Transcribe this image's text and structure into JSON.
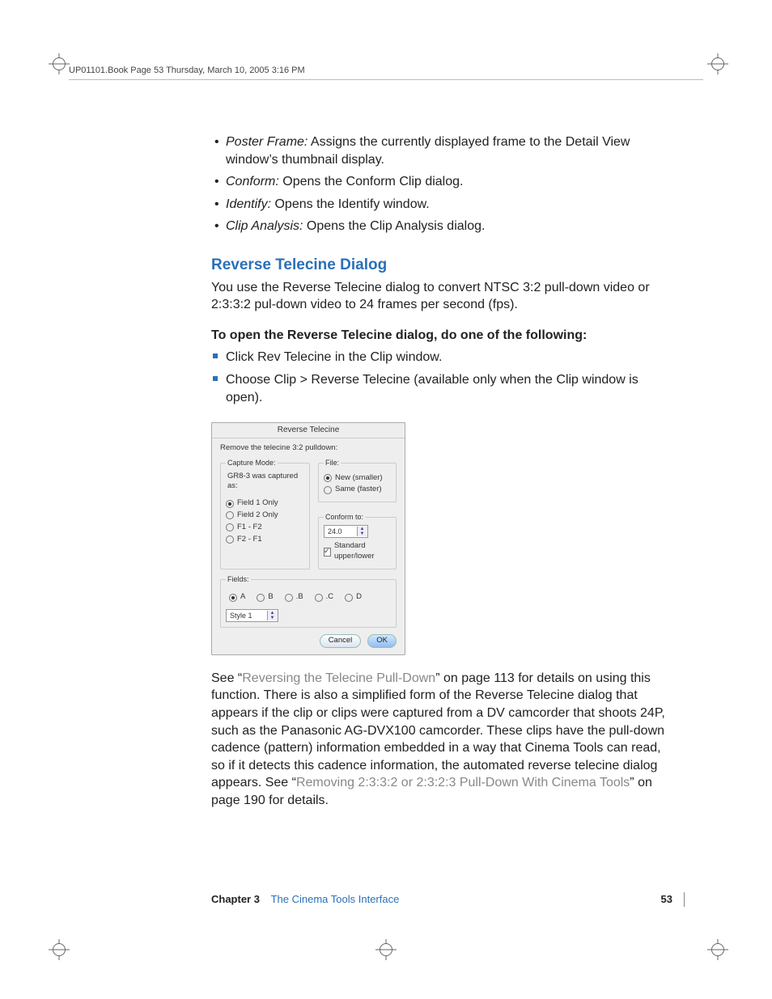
{
  "header": {
    "line": "UP01101.Book  Page 53  Thursday, March 10, 2005  3:16 PM"
  },
  "bullets": {
    "pf_label": "Poster Frame:",
    "pf_text": "  Assigns the currently displayed frame to the Detail View window’s thumbnail display.",
    "conf_label": "Conform:",
    "conf_text": "  Opens the Conform Clip dialog.",
    "id_label": "Identify:",
    "id_text": "  Opens the Identify window.",
    "ca_label": "Clip Analysis:",
    "ca_text": "  Opens the Clip Analysis dialog."
  },
  "section": {
    "heading": "Reverse Telecine Dialog",
    "intro": "You use the Reverse Telecine dialog to convert NTSC 3:2 pull-down video or 2:3:3:2 pul-down video to 24 frames per second (fps).",
    "open_label": "To open the Reverse Telecine dialog, do one of the following:",
    "steps": {
      "s1": "Click Rev Telecine in the Clip window.",
      "s2": "Choose Clip > Reverse Telecine (available only when the Clip window is open)."
    },
    "after1a": "See “",
    "after1_link": "Reversing the Telecine Pull-Down",
    "after1b": "” on page 113 for details on using this function. There is also a simplified form of the Reverse Telecine dialog that appears if the clip or clips were captured from a DV camcorder that shoots 24P, such as the Panasonic AG-DVX100 camcorder. These clips have the pull-down cadence (pattern) information embedded in a way that Cinema Tools can read, so if it detects this cadence information, the automated reverse telecine dialog appears. See “",
    "after2_link": "Removing 2:3:3:2 or 2:3:2:3 Pull-Down With Cinema Tools",
    "after2b": "” on page 190 for details."
  },
  "dialog": {
    "title": "Reverse Telecine",
    "subtitle": "Remove the telecine 3:2 pulldown:",
    "capture_legend": "Capture Mode:",
    "capture_desc": "GR8-3 was captured as:",
    "capture_opts": {
      "f1": "Field 1 Only",
      "f2": "Field 2 Only",
      "f12": "F1 - F2",
      "f21": "F2 - F1"
    },
    "file_legend": "File:",
    "file_opts": {
      "new": "New (smaller)",
      "same": "Same (faster)"
    },
    "conform_legend": "Conform to:",
    "conform_value": "24.0",
    "conform_chk": "Standard upper/lower",
    "fields_legend": "Fields:",
    "fields_opts": {
      "a": "A",
      "b": "B",
      "bb": ".B",
      "c": ".C",
      "d": "D"
    },
    "style_value": "Style 1",
    "btn_cancel": "Cancel",
    "btn_ok": "OK"
  },
  "footer": {
    "chapter_bold": "Chapter 3",
    "chapter_title": "The Cinema Tools Interface",
    "page": "53"
  }
}
